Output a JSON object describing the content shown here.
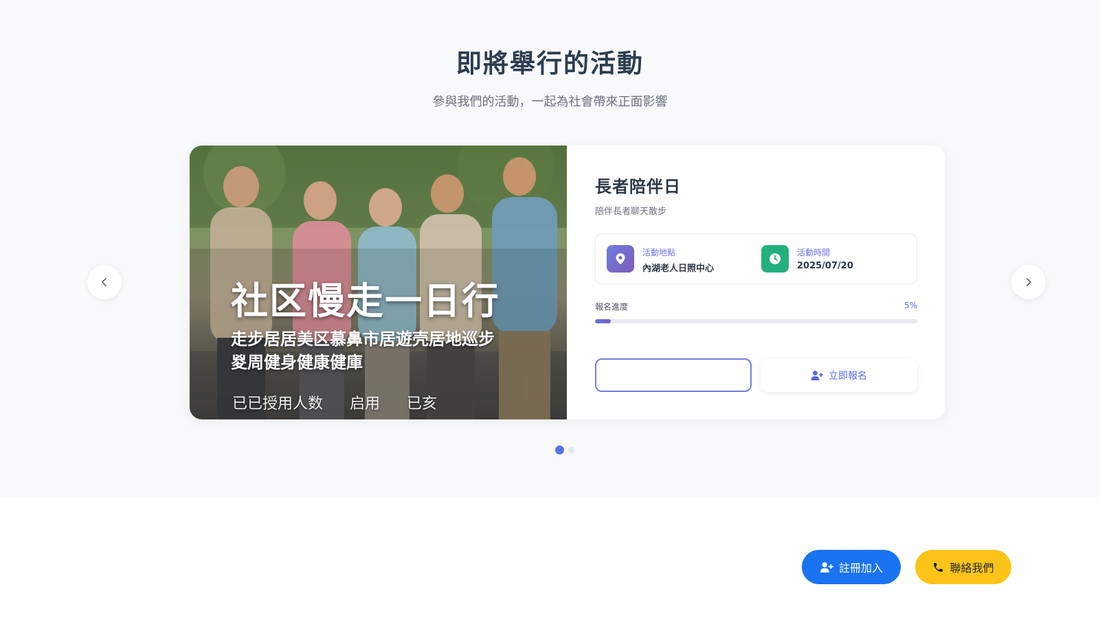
{
  "section": {
    "title": "即將舉行的活動",
    "subtitle": "參與我們的活動，一起為社會帶來正面影響"
  },
  "carousel": {
    "prev_icon": "chevron-left-icon",
    "next_icon": "chevron-right-icon",
    "slide_count": 2,
    "active_index": 0
  },
  "event": {
    "image_text": {
      "headline": "社区慢走一日行",
      "sub": "走步居居美区慕鼻市居遊壳居地巡步\n㚇周健身健康健庫",
      "stats": [
        "已已授用人数",
        "启用",
        "已亥"
      ]
    },
    "title": "長者陪伴日",
    "description": "陪伴長者聊天散步",
    "location_label": "活動地點",
    "location_value": "內湖老人日照中心",
    "time_label": "活動時間",
    "time_value": "2025/07/20",
    "progress_label": "報名進度",
    "progress_percent_text": "5%",
    "progress_value": 0.05,
    "outline_button_label": "",
    "register_label": "立即報名"
  },
  "floating": {
    "join_label": "註冊加入",
    "contact_label": "聯絡我們"
  },
  "colors": {
    "accent": "#5b6be0",
    "join": "#1a73f0",
    "contact": "#fcc419",
    "time_icon": "#22b07d"
  }
}
